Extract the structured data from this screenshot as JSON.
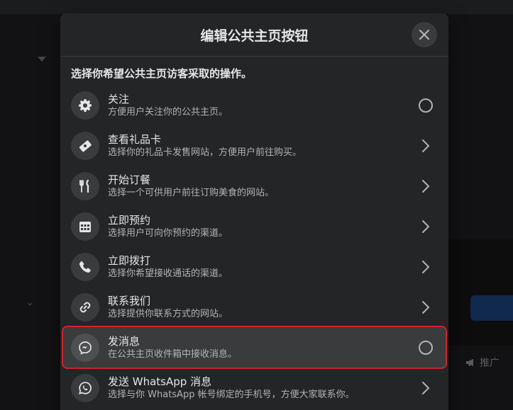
{
  "modal": {
    "title": "编辑公共主页按钮",
    "subtitle": "选择你希望公共主页访客采取的操作。"
  },
  "options": [
    {
      "title": "关注",
      "desc": "方便用户关注你的公共主页。",
      "icon": "gear-icon",
      "control": "radio"
    },
    {
      "title": "查看礼品卡",
      "desc": "选择你的礼品卡发售网站，方便用户前往购买。",
      "icon": "gift-card-icon",
      "control": "chevron"
    },
    {
      "title": "开始订餐",
      "desc": "选择一个可供用户前往订购美食的网站。",
      "icon": "fork-knife-icon",
      "control": "chevron"
    },
    {
      "title": "立即预约",
      "desc": "选择用户可向你预约的渠道。",
      "icon": "calendar-icon",
      "control": "chevron"
    },
    {
      "title": "立即拨打",
      "desc": "选择你希望接收通话的渠道。",
      "icon": "phone-icon",
      "control": "chevron"
    },
    {
      "title": "联系我们",
      "desc": "选择提供你联系方式的网站。",
      "icon": "link-icon",
      "control": "chevron"
    },
    {
      "title": "发消息",
      "desc": "在公共主页收件箱中接收消息。",
      "icon": "messenger-icon",
      "control": "radio",
      "selected": true
    },
    {
      "title": "发送 WhatsApp 消息",
      "desc": "选择与你 WhatsApp 帐号绑定的手机号，方便大家联系你。",
      "icon": "whatsapp-icon",
      "control": "chevron"
    }
  ],
  "background": {
    "promote_label": "推广"
  }
}
